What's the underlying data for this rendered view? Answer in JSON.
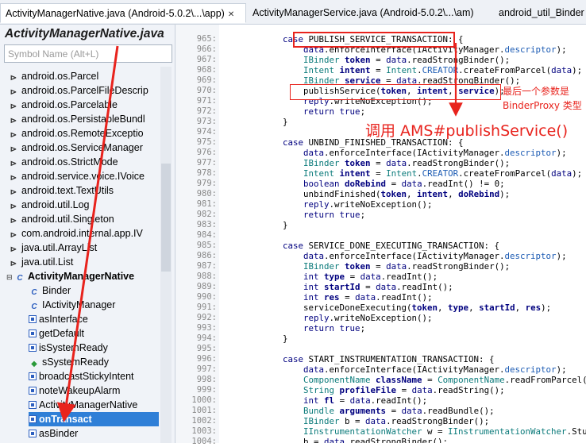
{
  "tabs": [
    {
      "label": "ActivityManagerNative.java (Android-5.0.2\\...\\app)",
      "active": true
    },
    {
      "label": "ActivityManagerService.java (Android-5.0.2\\...\\am)",
      "active": false
    },
    {
      "label": "android_util_Binder",
      "active": false
    }
  ],
  "outline": {
    "title": "ActivityManagerNative.java",
    "search_placeholder": "Symbol Name (Alt+L)",
    "items": [
      {
        "label": "android.os.Parcel",
        "icon": "package-icon"
      },
      {
        "label": "android.os.ParcelFileDescrip",
        "icon": "package-icon"
      },
      {
        "label": "android.os.Parcelable",
        "icon": "package-icon"
      },
      {
        "label": "android.os.PersistableBundl",
        "icon": "package-icon"
      },
      {
        "label": "android.os.RemoteExceptio",
        "icon": "package-icon"
      },
      {
        "label": "android.os.ServiceManager",
        "icon": "package-icon"
      },
      {
        "label": "android.os.StrictMode",
        "icon": "package-icon"
      },
      {
        "label": "android.service.voice.IVoice",
        "icon": "package-icon"
      },
      {
        "label": "android.text.TextUtils",
        "icon": "package-icon"
      },
      {
        "label": "android.util.Log",
        "icon": "package-icon"
      },
      {
        "label": "android.util.Singleton",
        "icon": "package-icon"
      },
      {
        "label": "com.android.internal.app.IV",
        "icon": "package-icon"
      },
      {
        "label": "java.util.ArrayList",
        "icon": "package-icon"
      },
      {
        "label": "java.util.List",
        "icon": "package-icon"
      },
      {
        "label": "ActivityManagerNative",
        "icon": "class-icon",
        "bold": true
      },
      {
        "label": "Binder",
        "icon": "class-icon"
      },
      {
        "label": "IActivityManager",
        "icon": "class-icon"
      },
      {
        "label": "asInterface",
        "icon": "method-icon"
      },
      {
        "label": "getDefault",
        "icon": "method-icon"
      },
      {
        "label": "isSystemReady",
        "icon": "method-icon"
      },
      {
        "label": "sSystemReady",
        "icon": "field-icon"
      },
      {
        "label": "broadcastStickyIntent",
        "icon": "method-icon"
      },
      {
        "label": "noteWakeupAlarm",
        "icon": "method-icon"
      },
      {
        "label": "ActivityManagerNative",
        "icon": "method-icon"
      },
      {
        "label": "onTransact",
        "icon": "method-icon",
        "selected": true
      },
      {
        "label": "asBinder",
        "icon": "method-icon"
      }
    ]
  },
  "line_numbers": [
    "965:",
    "966:",
    "967:",
    "968:",
    "969:",
    "970:",
    "971:",
    "972:",
    "973:",
    "974:",
    "975:",
    "976:",
    "977:",
    "978:",
    "979:",
    "980:",
    "981:",
    "982:",
    "983:",
    "984:",
    "985:",
    "986:",
    "987:",
    "988:",
    "989:",
    "990:",
    "991:",
    "992:",
    "993:",
    "994:",
    "995:",
    "996:",
    "997:",
    "998:",
    "999:",
    "1000:",
    "1001:",
    "1002:",
    "1003:",
    "1004:"
  ],
  "code_lines": [
    "            case PUBLISH_SERVICE_TRANSACTION: {",
    "                data.enforceInterface(IActivityManager.descriptor);",
    "                IBinder token = data.readStrongBinder();",
    "                Intent intent = Intent.CREATOR.createFromParcel(data);",
    "                IBinder service = data.readStrongBinder();",
    "                publishService(token, intent, service);",
    "                reply.writeNoException();",
    "                return true;",
    "            }",
    "",
    "            case UNBIND_FINISHED_TRANSACTION: {",
    "                data.enforceInterface(IActivityManager.descriptor);",
    "                IBinder token = data.readStrongBinder();",
    "                Intent intent = Intent.CREATOR.createFromParcel(data);",
    "                boolean doRebind = data.readInt() != 0;",
    "                unbindFinished(token, intent, doRebind);",
    "                reply.writeNoException();",
    "                return true;",
    "            }",
    "",
    "            case SERVICE_DONE_EXECUTING_TRANSACTION: {",
    "                data.enforceInterface(IActivityManager.descriptor);",
    "                IBinder token = data.readStrongBinder();",
    "                int type = data.readInt();",
    "                int startId = data.readInt();",
    "                int res = data.readInt();",
    "                serviceDoneExecuting(token, type, startId, res);",
    "                reply.writeNoException();",
    "                return true;",
    "            }",
    "",
    "            case START_INSTRUMENTATION_TRANSACTION: {",
    "                data.enforceInterface(IActivityManager.descriptor);",
    "                ComponentName className = ComponentName.readFromParcel(data);",
    "                String profileFile = data.readString();",
    "                int fl = data.readInt();",
    "                Bundle arguments = data.readBundle();",
    "                IBinder b = data.readStrongBinder();",
    "                IInstrumentationWatcher w = IInstrumentationWatcher.Stub.asInterface(b);",
    "                b = data.readStrongBinder();"
  ],
  "annotations": {
    "last_param_line1": "最后一个参数是",
    "last_param_line2": "BinderProxy 类型",
    "call_ams": "调用 AMS#publishService()"
  },
  "colors": {
    "annotation_red": "#e8231d",
    "selection_blue": "#2f7fd7"
  }
}
